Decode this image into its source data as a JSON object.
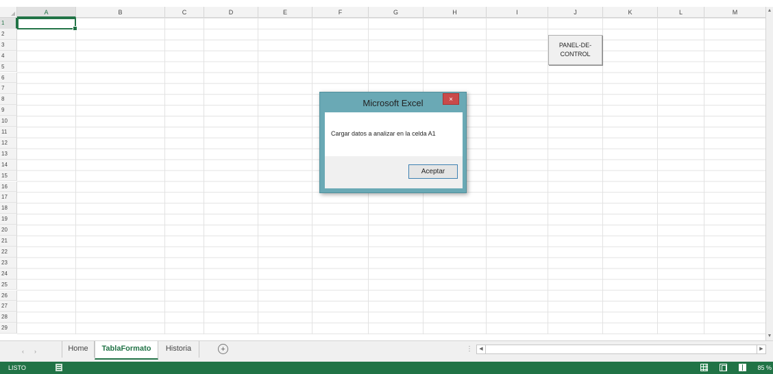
{
  "spreadsheet": {
    "columns": [
      "A",
      "B",
      "C",
      "D",
      "E",
      "F",
      "G",
      "H",
      "I",
      "J",
      "K",
      "L",
      "M"
    ],
    "rows": [
      "1",
      "2",
      "3",
      "4",
      "5",
      "6",
      "7",
      "8",
      "9",
      "10",
      "11",
      "12",
      "13",
      "14",
      "15",
      "16",
      "17",
      "18",
      "19",
      "20",
      "21",
      "22",
      "23",
      "24",
      "25",
      "26",
      "27",
      "28",
      "29"
    ],
    "selected_column": "A",
    "selected_row": "1"
  },
  "panel_button": {
    "label": "PANEL-DE-CONTROL"
  },
  "dialog": {
    "title": "Microsoft Excel",
    "close_label": "×",
    "message": "Cargar datos a analizar en la celda A1",
    "ok_label": "Aceptar"
  },
  "sheet_tabs": {
    "nav_prev": "‹",
    "nav_next": "›",
    "tabs": [
      "Home",
      "TablaFormato",
      "Historia"
    ],
    "active_tab": "TablaFormato",
    "add_label": "+"
  },
  "status_bar": {
    "status": "LISTO",
    "zoom": "85 %",
    "accent_color": "#217346"
  }
}
